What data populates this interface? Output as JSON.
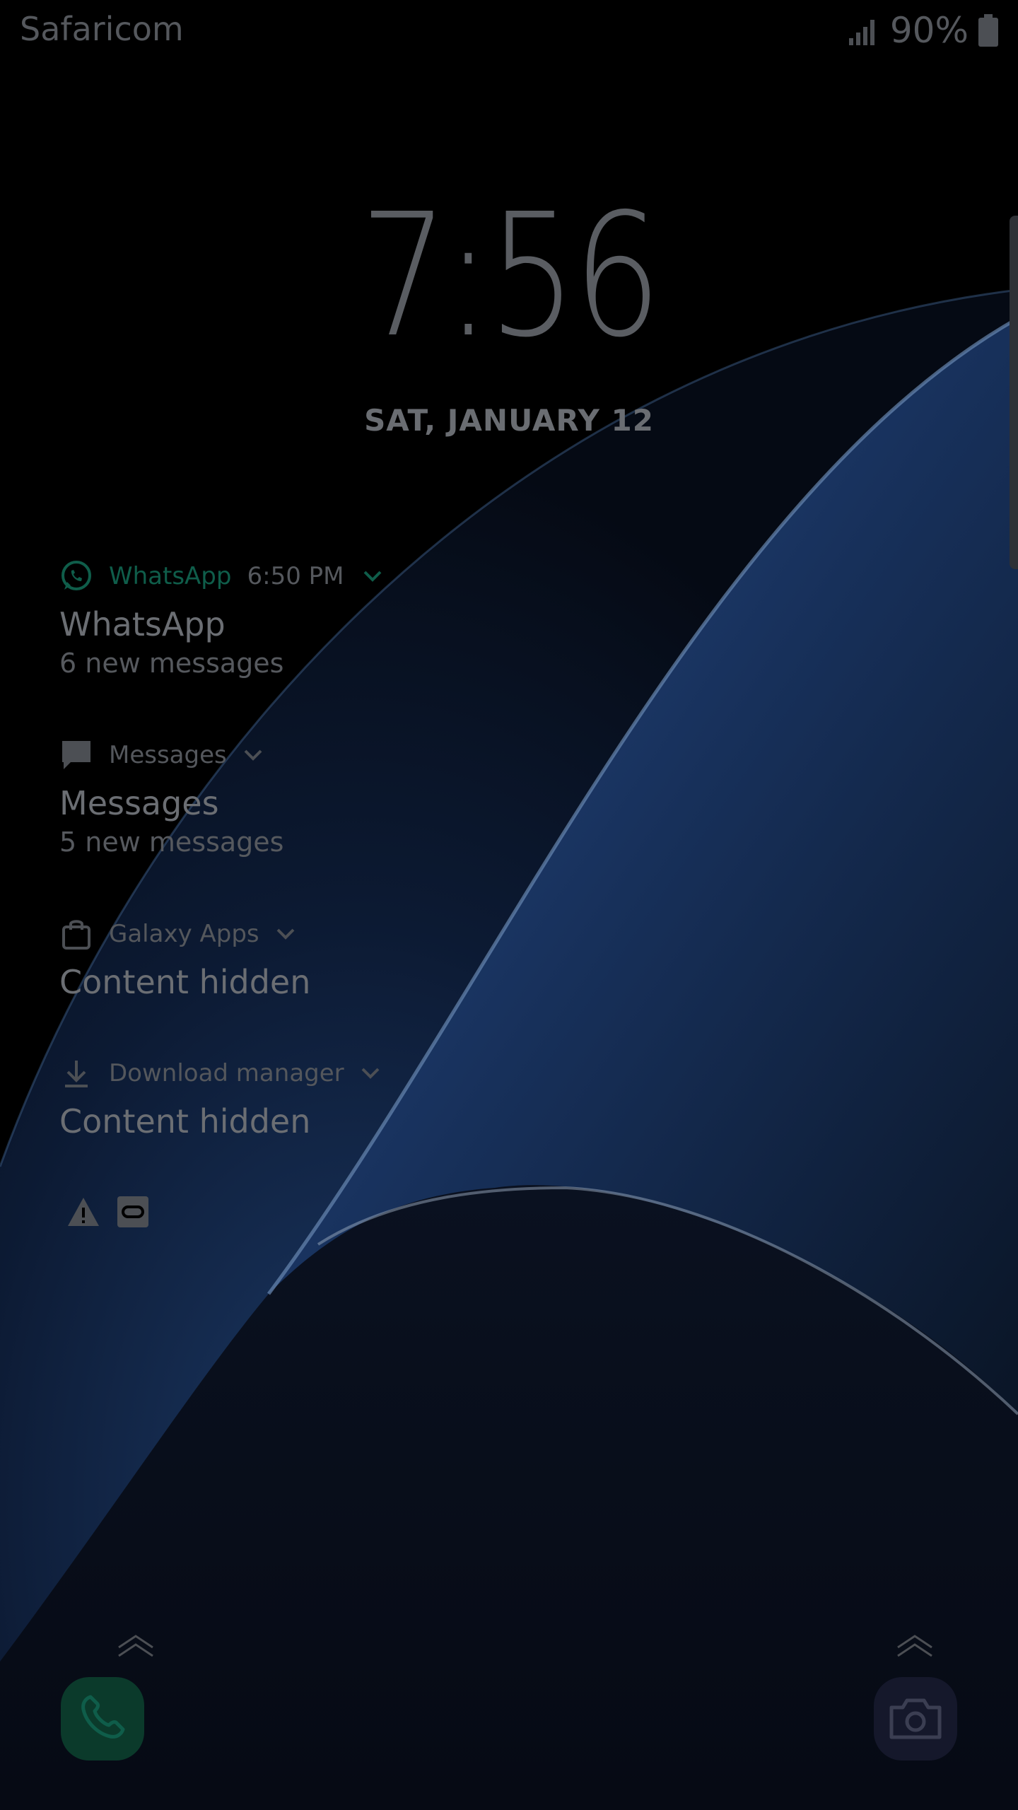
{
  "status_bar": {
    "carrier": "Safaricom",
    "battery_percent": "90%",
    "icons": [
      "signal-icon",
      "battery-icon"
    ]
  },
  "lock_screen": {
    "time": "7:56",
    "date": "SAT, JANUARY 12"
  },
  "notifications": [
    {
      "icon": "whatsapp-icon",
      "app": "WhatsApp",
      "time": "6:50 PM",
      "title": "WhatsApp",
      "body": "6 new messages"
    },
    {
      "icon": "message-bubble-icon",
      "app": "Messages",
      "title": "Messages",
      "body": "5 new messages"
    },
    {
      "icon": "shopping-bag-icon",
      "app": "Galaxy Apps",
      "title": "Content hidden"
    },
    {
      "icon": "download-icon",
      "app": "Download manager",
      "title": "Content hidden"
    }
  ],
  "status_icons": [
    "warning-icon",
    "vr-headset-icon"
  ],
  "shortcuts": {
    "left": "phone-icon",
    "right": "camera-icon"
  },
  "colors": {
    "whatsapp_green": "#0f5d4a",
    "phone_bg": "#0b3a2b",
    "camera_bg": "#15182b",
    "wallpaper_blue": "#1e3c6e"
  }
}
